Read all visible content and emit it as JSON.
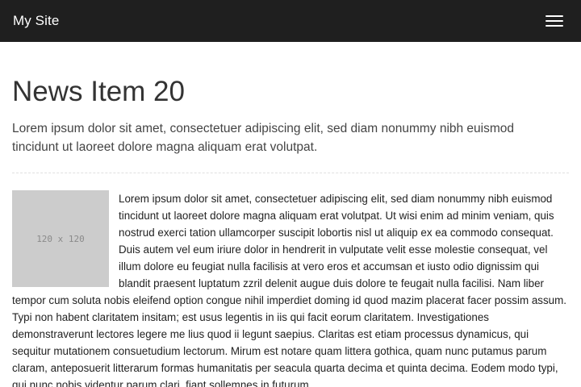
{
  "navbar": {
    "brand": "My Site",
    "menu_icon": "hamburger-menu-icon"
  },
  "page": {
    "title": "News Item 20",
    "lead": "Lorem ipsum dolor sit amet, consectetuer adipiscing elit, sed diam nonummy nibh euismod tincidunt ut laoreet dolore magna aliquam erat volutpat."
  },
  "article": {
    "image_placeholder": "120 x 120",
    "body": "Lorem ipsum dolor sit amet, consectetuer adipiscing elit, sed diam nonummy nibh euismod tincidunt ut laoreet dolore magna aliquam erat volutpat. Ut wisi enim ad minim veniam, quis nostrud exerci tation ullamcorper suscipit lobortis nisl ut aliquip ex ea commodo consequat. Duis autem vel eum iriure dolor in hendrerit in vulputate velit esse molestie consequat, vel illum dolore eu feugiat nulla facilisis at vero eros et accumsan et iusto odio dignissim qui blandit praesent luptatum zzril delenit augue duis dolore te feugait nulla facilisi. Nam liber tempor cum soluta nobis eleifend option congue nihil imperdiet doming id quod mazim placerat facer possim assum. Typi non habent claritatem insitam; est usus legentis in iis qui facit eorum claritatem. Investigationes demonstraverunt lectores legere me lius quod ii legunt saepius. Claritas est etiam processus dynamicus, qui sequitur mutationem consuetudium lectorum. Mirum est notare quam littera gothica, quam nunc putamus parum claram, anteposuerit litterarum formas humanitatis per seacula quarta decima et quinta decima. Eodem modo typi, qui nunc nobis videntur parum clari, fiant sollemnes in futurum."
  }
}
